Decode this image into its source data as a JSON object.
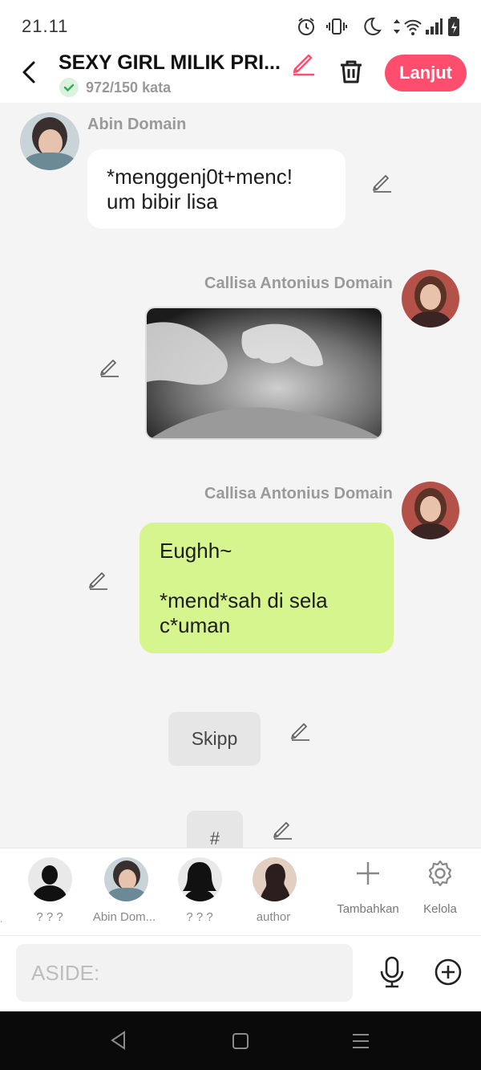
{
  "status_bar": {
    "time": "21.11",
    "icons": [
      "alarm-icon",
      "vibrate-icon",
      "moon-icon",
      "data-arrows-icon",
      "wifi-icon",
      "signal-icon",
      "battery-icon"
    ]
  },
  "header": {
    "title": "SEXY GIRL MILIK PRI...",
    "word_count": "972/150 kata",
    "next_label": "Lanjut",
    "accent_color": "#ff4e6d"
  },
  "messages": [
    {
      "sender": "Abin Domain",
      "text": "*menggenj0t+menc!\num bibir lisa",
      "side": "left",
      "bubble_color": "#ffffff"
    },
    {
      "sender": "Callisa Antonius Domain",
      "type": "image",
      "side": "right"
    },
    {
      "sender": "Callisa Antonius Domain",
      "text": "Eughh~\n\n*mend*sah di sela\nc*uman",
      "side": "right",
      "bubble_color": "#d6f58f"
    },
    {
      "text": "Skipp",
      "type": "narration"
    },
    {
      "text": "#",
      "type": "narration"
    }
  ],
  "characters": [
    {
      "label": "? ? ?"
    },
    {
      "label": "Abin Dom..."
    },
    {
      "label": "? ? ?"
    },
    {
      "label": "author"
    }
  ],
  "actions": {
    "add_label": "Tambahkan",
    "manage_label": "Kelola"
  },
  "input": {
    "placeholder": "ASIDE:"
  }
}
